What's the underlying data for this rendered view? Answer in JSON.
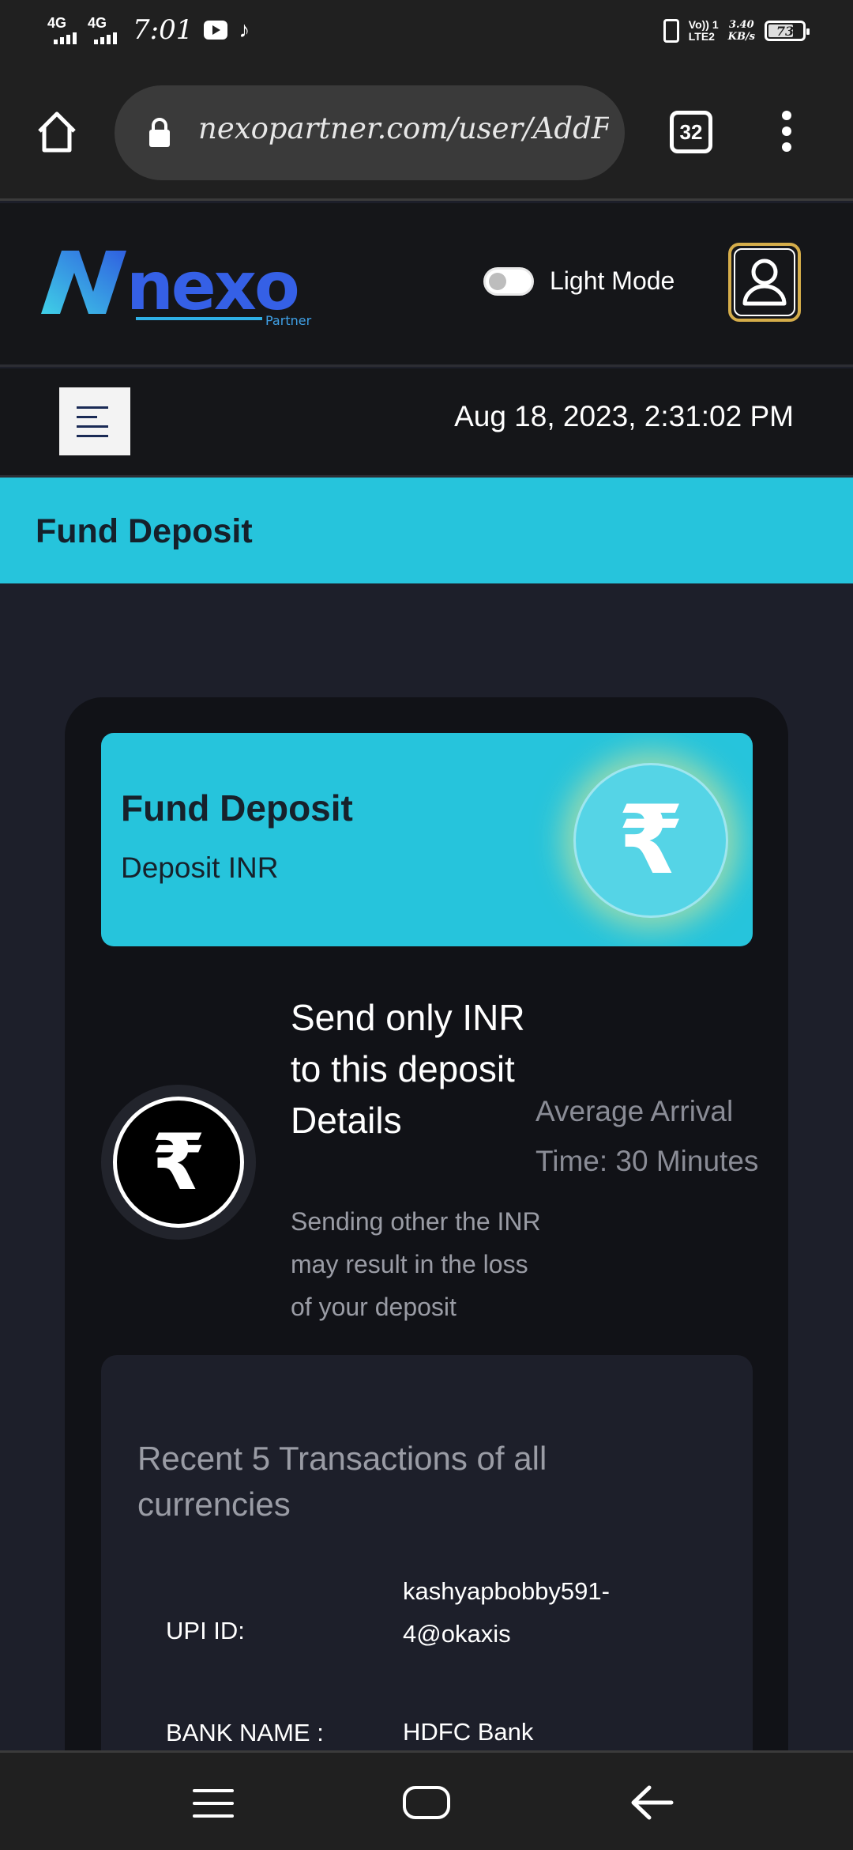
{
  "status_bar": {
    "network_1": "4G",
    "network_2": "4G",
    "time": "7:01",
    "volte": "Vo)) 1",
    "lte": "LTE2",
    "speed_value": "3.40",
    "speed_unit": "KB/s",
    "battery": "73",
    "battery_level": 0.73
  },
  "browser": {
    "url": "nexopartner.com/user/AddFund",
    "tab_count": "32"
  },
  "header": {
    "logo_text": "nexo",
    "logo_sub": "Partner",
    "theme_toggle_label": "Light Mode"
  },
  "date_bar": {
    "datetime": "Aug 18, 2023, 2:31:02 PM"
  },
  "page_title": "Fund Deposit",
  "deposit_card": {
    "title": "Fund Deposit",
    "subtitle": "Deposit INR",
    "currency_symbol": "₹"
  },
  "notice": {
    "currency_symbol": "₹",
    "title": "Send only INR to this deposit Details",
    "warning": "Sending other the INR may result in the loss of your deposit",
    "arrival": "Average Arrival Time: 30 Minutes"
  },
  "transactions": {
    "title": "Recent 5 Transactions of all currencies",
    "rows": [
      {
        "label": "UPI ID:",
        "value": "kashyapbobby591-4@okaxis"
      },
      {
        "label": "BANK NAME :",
        "value": "HDFC Bank"
      }
    ]
  },
  "colors": {
    "accent": "#26c4dc",
    "background": "#1d1f2a",
    "card": "#111217",
    "profile_border": "#d5ad4a"
  }
}
